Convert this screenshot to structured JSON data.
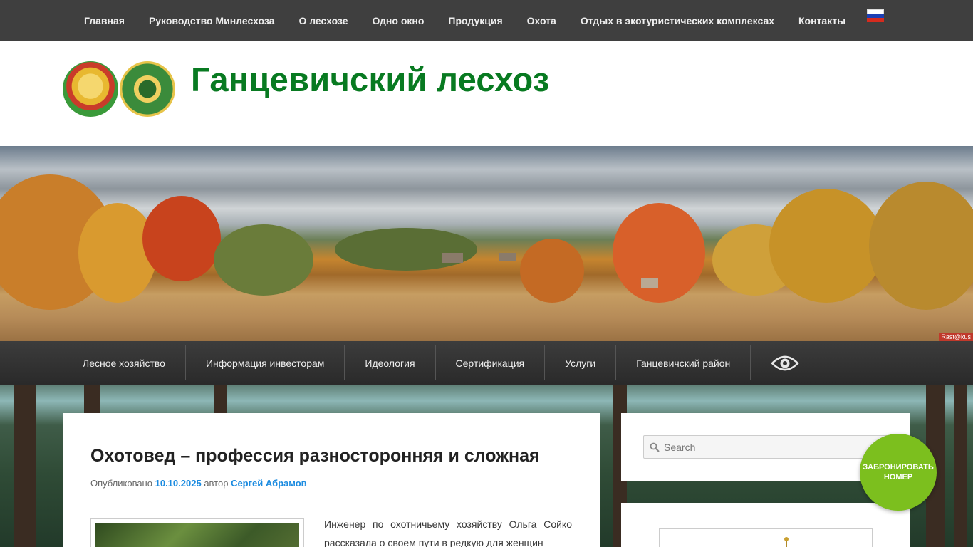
{
  "top_nav": {
    "items": [
      "Главная",
      "Руководство Минлесхоза",
      "О лесхозе",
      "Одно окно",
      "Продукция",
      "Охота",
      "Отдых в экотуристических комплексах",
      "Контакты"
    ],
    "flag": {
      "name": "russian-flag-icon",
      "colors": [
        "#ffffff",
        "#1c3fb3",
        "#d52b1e"
      ]
    }
  },
  "header": {
    "site_title": "Ганцевичский лесхоз",
    "title_color": "#087a21"
  },
  "banner": {
    "credit": "Rast@kus"
  },
  "sub_nav": {
    "items": [
      "Лесное хозяйство",
      "Информация инвесторам",
      "Идеология",
      "Сертификация",
      "Услуги",
      "Ганцевичский район"
    ],
    "eye_icon": "eye-icon"
  },
  "post": {
    "title": "Охотовед – профессия разносторонняя и сложная",
    "meta_prefix": "Опубликовано",
    "date": "10.10.2025",
    "author_prefix": "автор",
    "author": "Сергей Абрамов",
    "excerpt": "Инженер по охотничьему хозяйству Ольга Сойко рассказала о своем пути в редкую для женщин"
  },
  "sidebar": {
    "search_placeholder": "Search"
  },
  "book_button": {
    "label": "ЗАБРОНИРОВАТЬ НОМЕР",
    "color": "#7cbf1e"
  }
}
